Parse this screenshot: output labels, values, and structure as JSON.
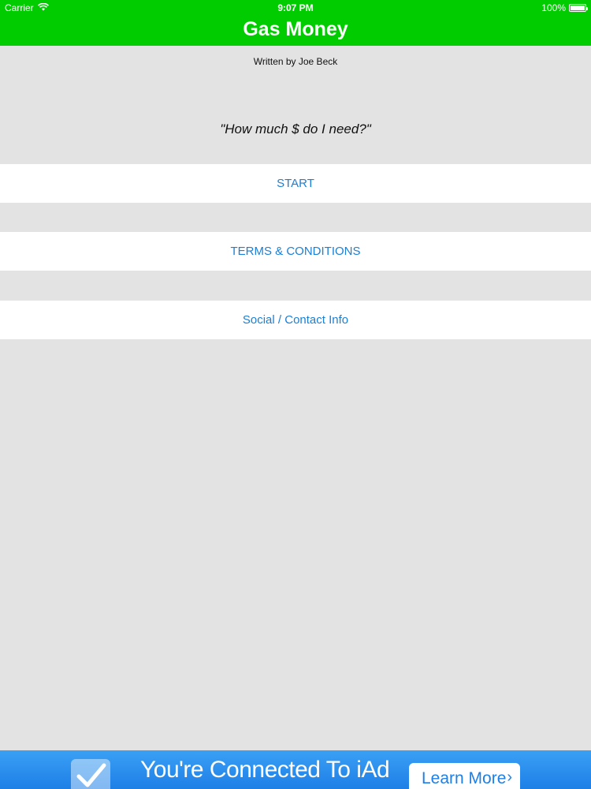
{
  "status_bar": {
    "carrier": "Carrier",
    "time": "9:07 PM",
    "battery": "100%",
    "icons": [
      "wifi-icon",
      "battery-icon"
    ]
  },
  "nav": {
    "title": "Gas Money"
  },
  "author": "Written by Joe Beck",
  "tagline": "\"How much $ do I need?\"",
  "menu": {
    "start": "START",
    "terms": "TERMS & CONDITIONS",
    "social": "Social / Contact Info"
  },
  "ad": {
    "text": "You're Connected To iAd",
    "button": "Learn More",
    "chevron": "›",
    "icon": "checkmark-icon"
  },
  "colors": {
    "nav_green": "#00cc00",
    "background": "#e3e3e4",
    "button_bg": "#ffffff",
    "button_text": "#1a7fd6",
    "ad_blue": "#1e7fe6"
  }
}
